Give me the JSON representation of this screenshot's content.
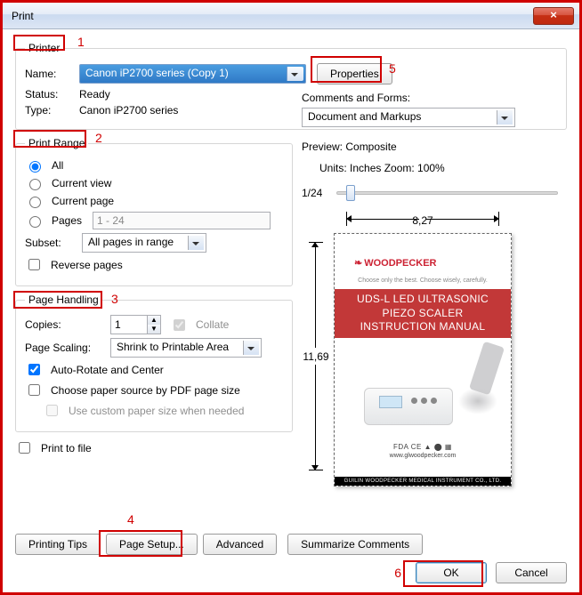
{
  "window": {
    "title": "Print"
  },
  "annotations": {
    "n1": "1",
    "n2": "2",
    "n3": "3",
    "n4": "4",
    "n5": "5",
    "n6": "6"
  },
  "printer": {
    "legend": "Printer",
    "name_label": "Name:",
    "name_value": "Canon iP2700 series (Copy 1)",
    "properties_btn": "Properties",
    "status_label": "Status:",
    "status_value": "Ready",
    "type_label": "Type:",
    "type_value": "Canon iP2700 series",
    "comments_label": "Comments and Forms:",
    "comments_value": "Document and Markups"
  },
  "range": {
    "legend": "Print Range",
    "all": "All",
    "current_view": "Current view",
    "current_page": "Current page",
    "pages_label": "Pages",
    "pages_value": "1 - 24",
    "subset_label": "Subset:",
    "subset_value": "All pages in range",
    "reverse": "Reverse pages"
  },
  "handling": {
    "legend": "Page Handling",
    "copies_label": "Copies:",
    "copies_value": "1",
    "collate": "Collate",
    "scaling_label": "Page Scaling:",
    "scaling_value": "Shrink to Printable Area",
    "autorotate": "Auto-Rotate and Center",
    "choose_source": "Choose paper source by PDF page size",
    "custom_size": "Use custom paper size when needed"
  },
  "print_to_file": "Print to file",
  "preview": {
    "title": "Preview: Composite",
    "units": "Units: Inches Zoom: 100%",
    "page_indicator": "1/24",
    "width": "8,27",
    "height": "11,69",
    "doc": {
      "brand": "WOODPECKER",
      "tagline": "Choose only the best. Choose wisely, carefully.",
      "title_line1": "UDS-L LED ULTRASONIC PIEZO SCALER",
      "title_line2": "INSTRUCTION MANUAL",
      "marks": "FDA CE ▲ ⬤ ▦",
      "site": "www.glwoodpecker.com",
      "footer": "GUILIN WOODPECKER MEDICAL INSTRUMENT CO., LTD."
    }
  },
  "buttons": {
    "printing_tips": "Printing Tips",
    "page_setup": "Page Setup...",
    "advanced": "Advanced",
    "summarize": "Summarize Comments",
    "ok": "OK",
    "cancel": "Cancel"
  }
}
